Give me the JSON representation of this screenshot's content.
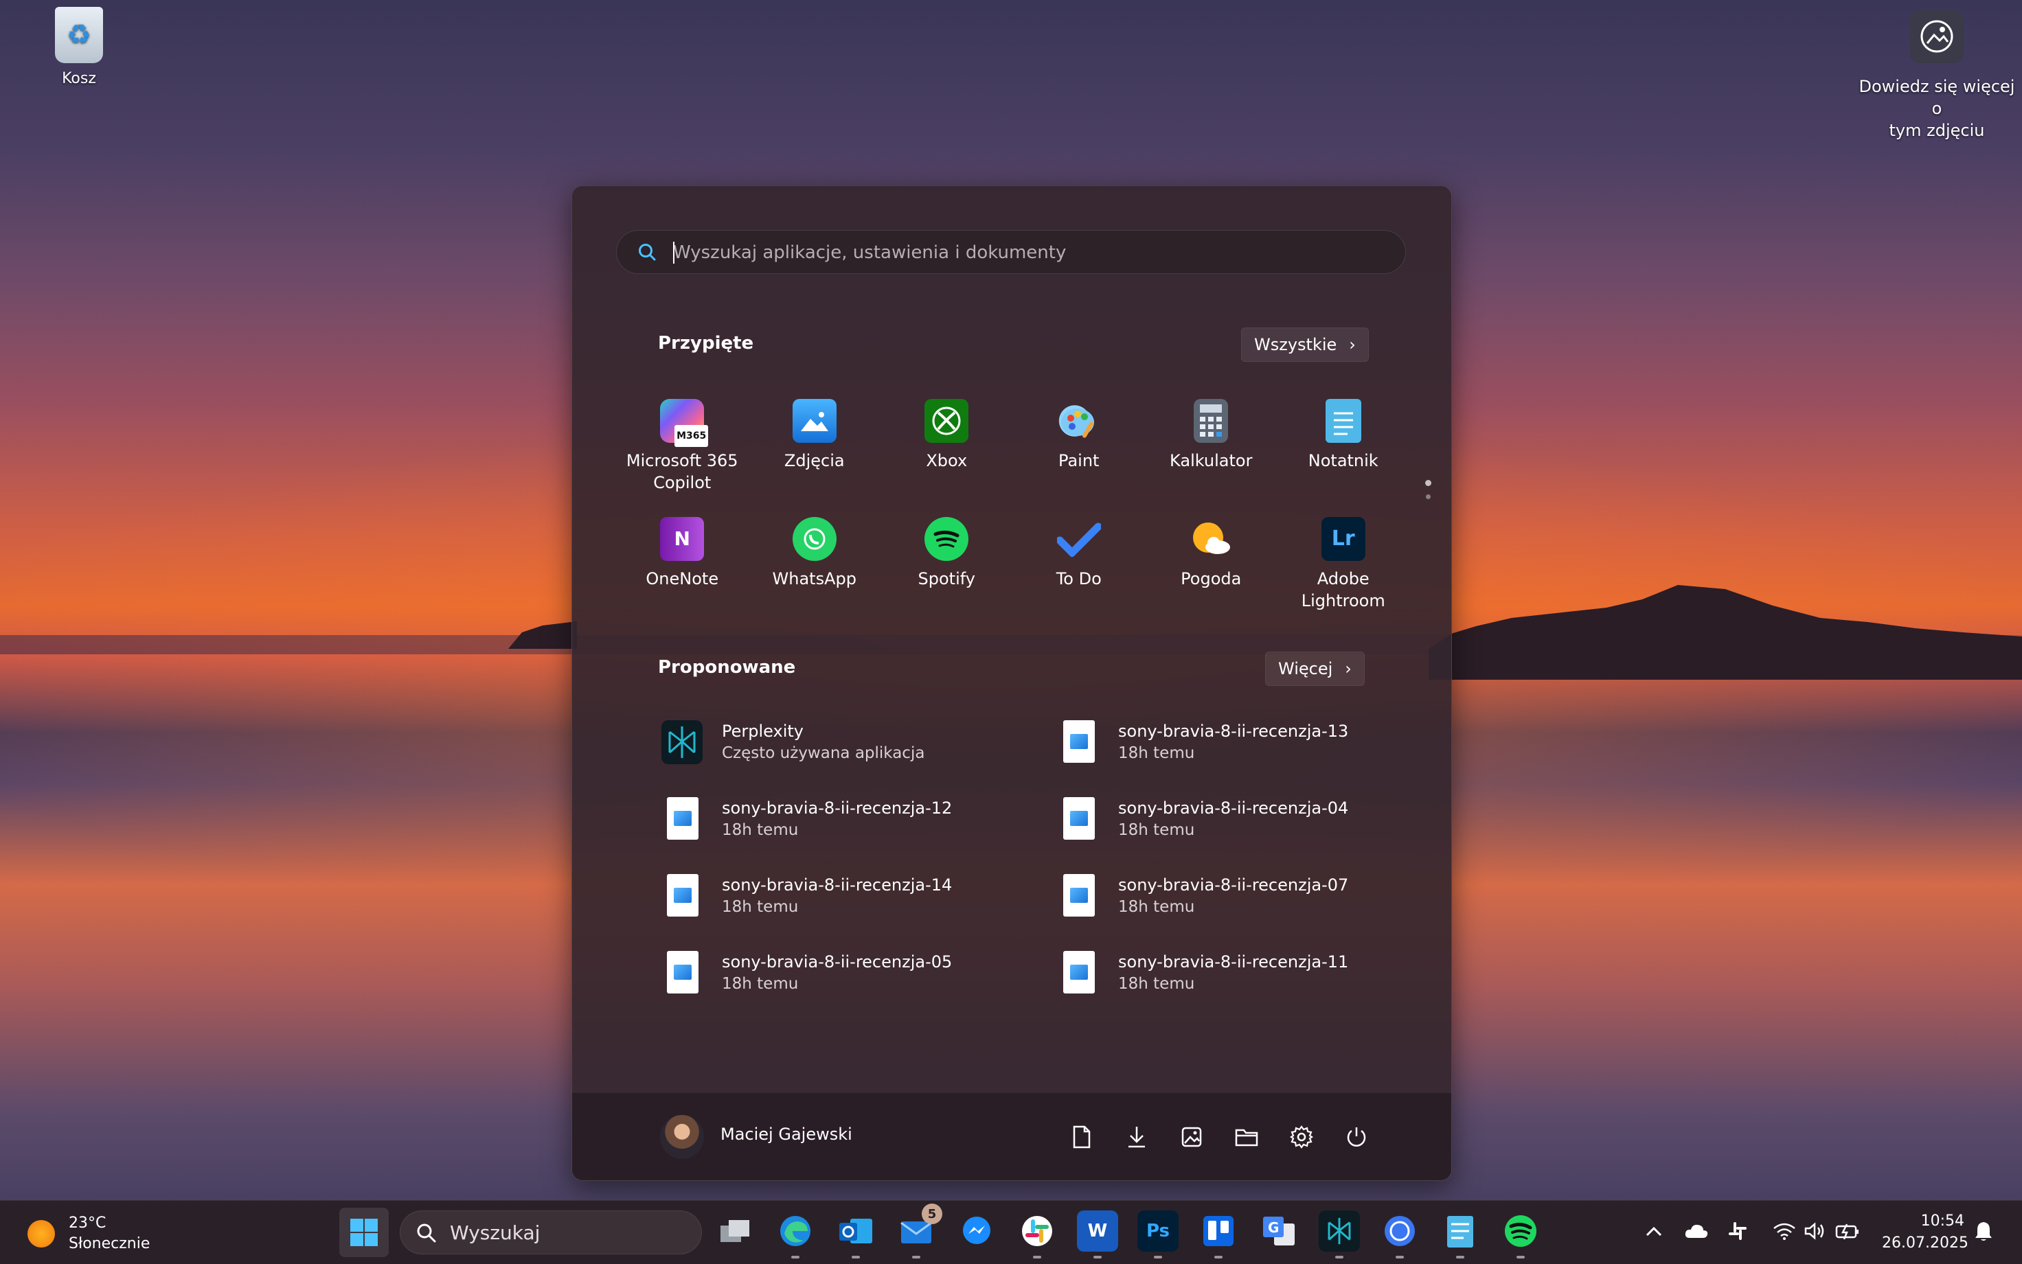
{
  "desktop": {
    "recycle_bin_label": "Kosz",
    "learn_more_line1": "Dowiedz się więcej o",
    "learn_more_line2": "tym zdjęciu"
  },
  "start_menu": {
    "search_placeholder": "Wyszukaj aplikacje, ustawienia i dokumenty",
    "pinned": {
      "title": "Przypięte",
      "all_button": "Wszystkie",
      "apps": [
        {
          "line1": "Microsoft 365",
          "line2": "Copilot",
          "icon": "m365-copilot-icon"
        },
        {
          "line1": "Zdjęcia",
          "line2": "",
          "icon": "photos-icon"
        },
        {
          "line1": "Xbox",
          "line2": "",
          "icon": "xbox-icon"
        },
        {
          "line1": "Paint",
          "line2": "",
          "icon": "paint-icon"
        },
        {
          "line1": "Kalkulator",
          "line2": "",
          "icon": "calculator-icon"
        },
        {
          "line1": "Notatnik",
          "line2": "",
          "icon": "notepad-icon"
        },
        {
          "line1": "OneNote",
          "line2": "",
          "icon": "onenote-icon"
        },
        {
          "line1": "WhatsApp",
          "line2": "",
          "icon": "whatsapp-icon"
        },
        {
          "line1": "Spotify",
          "line2": "",
          "icon": "spotify-icon"
        },
        {
          "line1": "To Do",
          "line2": "",
          "icon": "todo-icon"
        },
        {
          "line1": "Pogoda",
          "line2": "",
          "icon": "weather-icon"
        },
        {
          "line1": "Adobe",
          "line2": "Lightroom",
          "icon": "lightroom-icon"
        }
      ]
    },
    "recommended": {
      "title": "Proponowane",
      "more_button": "Więcej",
      "items": [
        {
          "name": "Perplexity",
          "sub": "Często używana aplikacja",
          "icon": "perplexity-icon"
        },
        {
          "name": "sony-bravia-8-ii-recenzja-13",
          "sub": "18h temu",
          "icon": "image-file-icon"
        },
        {
          "name": "sony-bravia-8-ii-recenzja-12",
          "sub": "18h temu",
          "icon": "image-file-icon"
        },
        {
          "name": "sony-bravia-8-ii-recenzja-04",
          "sub": "18h temu",
          "icon": "image-file-icon"
        },
        {
          "name": "sony-bravia-8-ii-recenzja-14",
          "sub": "18h temu",
          "icon": "image-file-icon"
        },
        {
          "name": "sony-bravia-8-ii-recenzja-07",
          "sub": "18h temu",
          "icon": "image-file-icon"
        },
        {
          "name": "sony-bravia-8-ii-recenzja-05",
          "sub": "18h temu",
          "icon": "image-file-icon"
        },
        {
          "name": "sony-bravia-8-ii-recenzja-11",
          "sub": "18h temu",
          "icon": "image-file-icon"
        }
      ]
    },
    "user_name": "Maciej Gajewski"
  },
  "taskbar": {
    "weather_temp": "23°C",
    "weather_desc": "Słonecznie",
    "search_label": "Wyszukaj",
    "outlook_badge": "5",
    "time": "10:54",
    "date": "26.07.2025",
    "ps_label": "Ps",
    "lr_label": "Lr",
    "w_label": "W",
    "n_label": "N",
    "m365_badge": "M365"
  }
}
